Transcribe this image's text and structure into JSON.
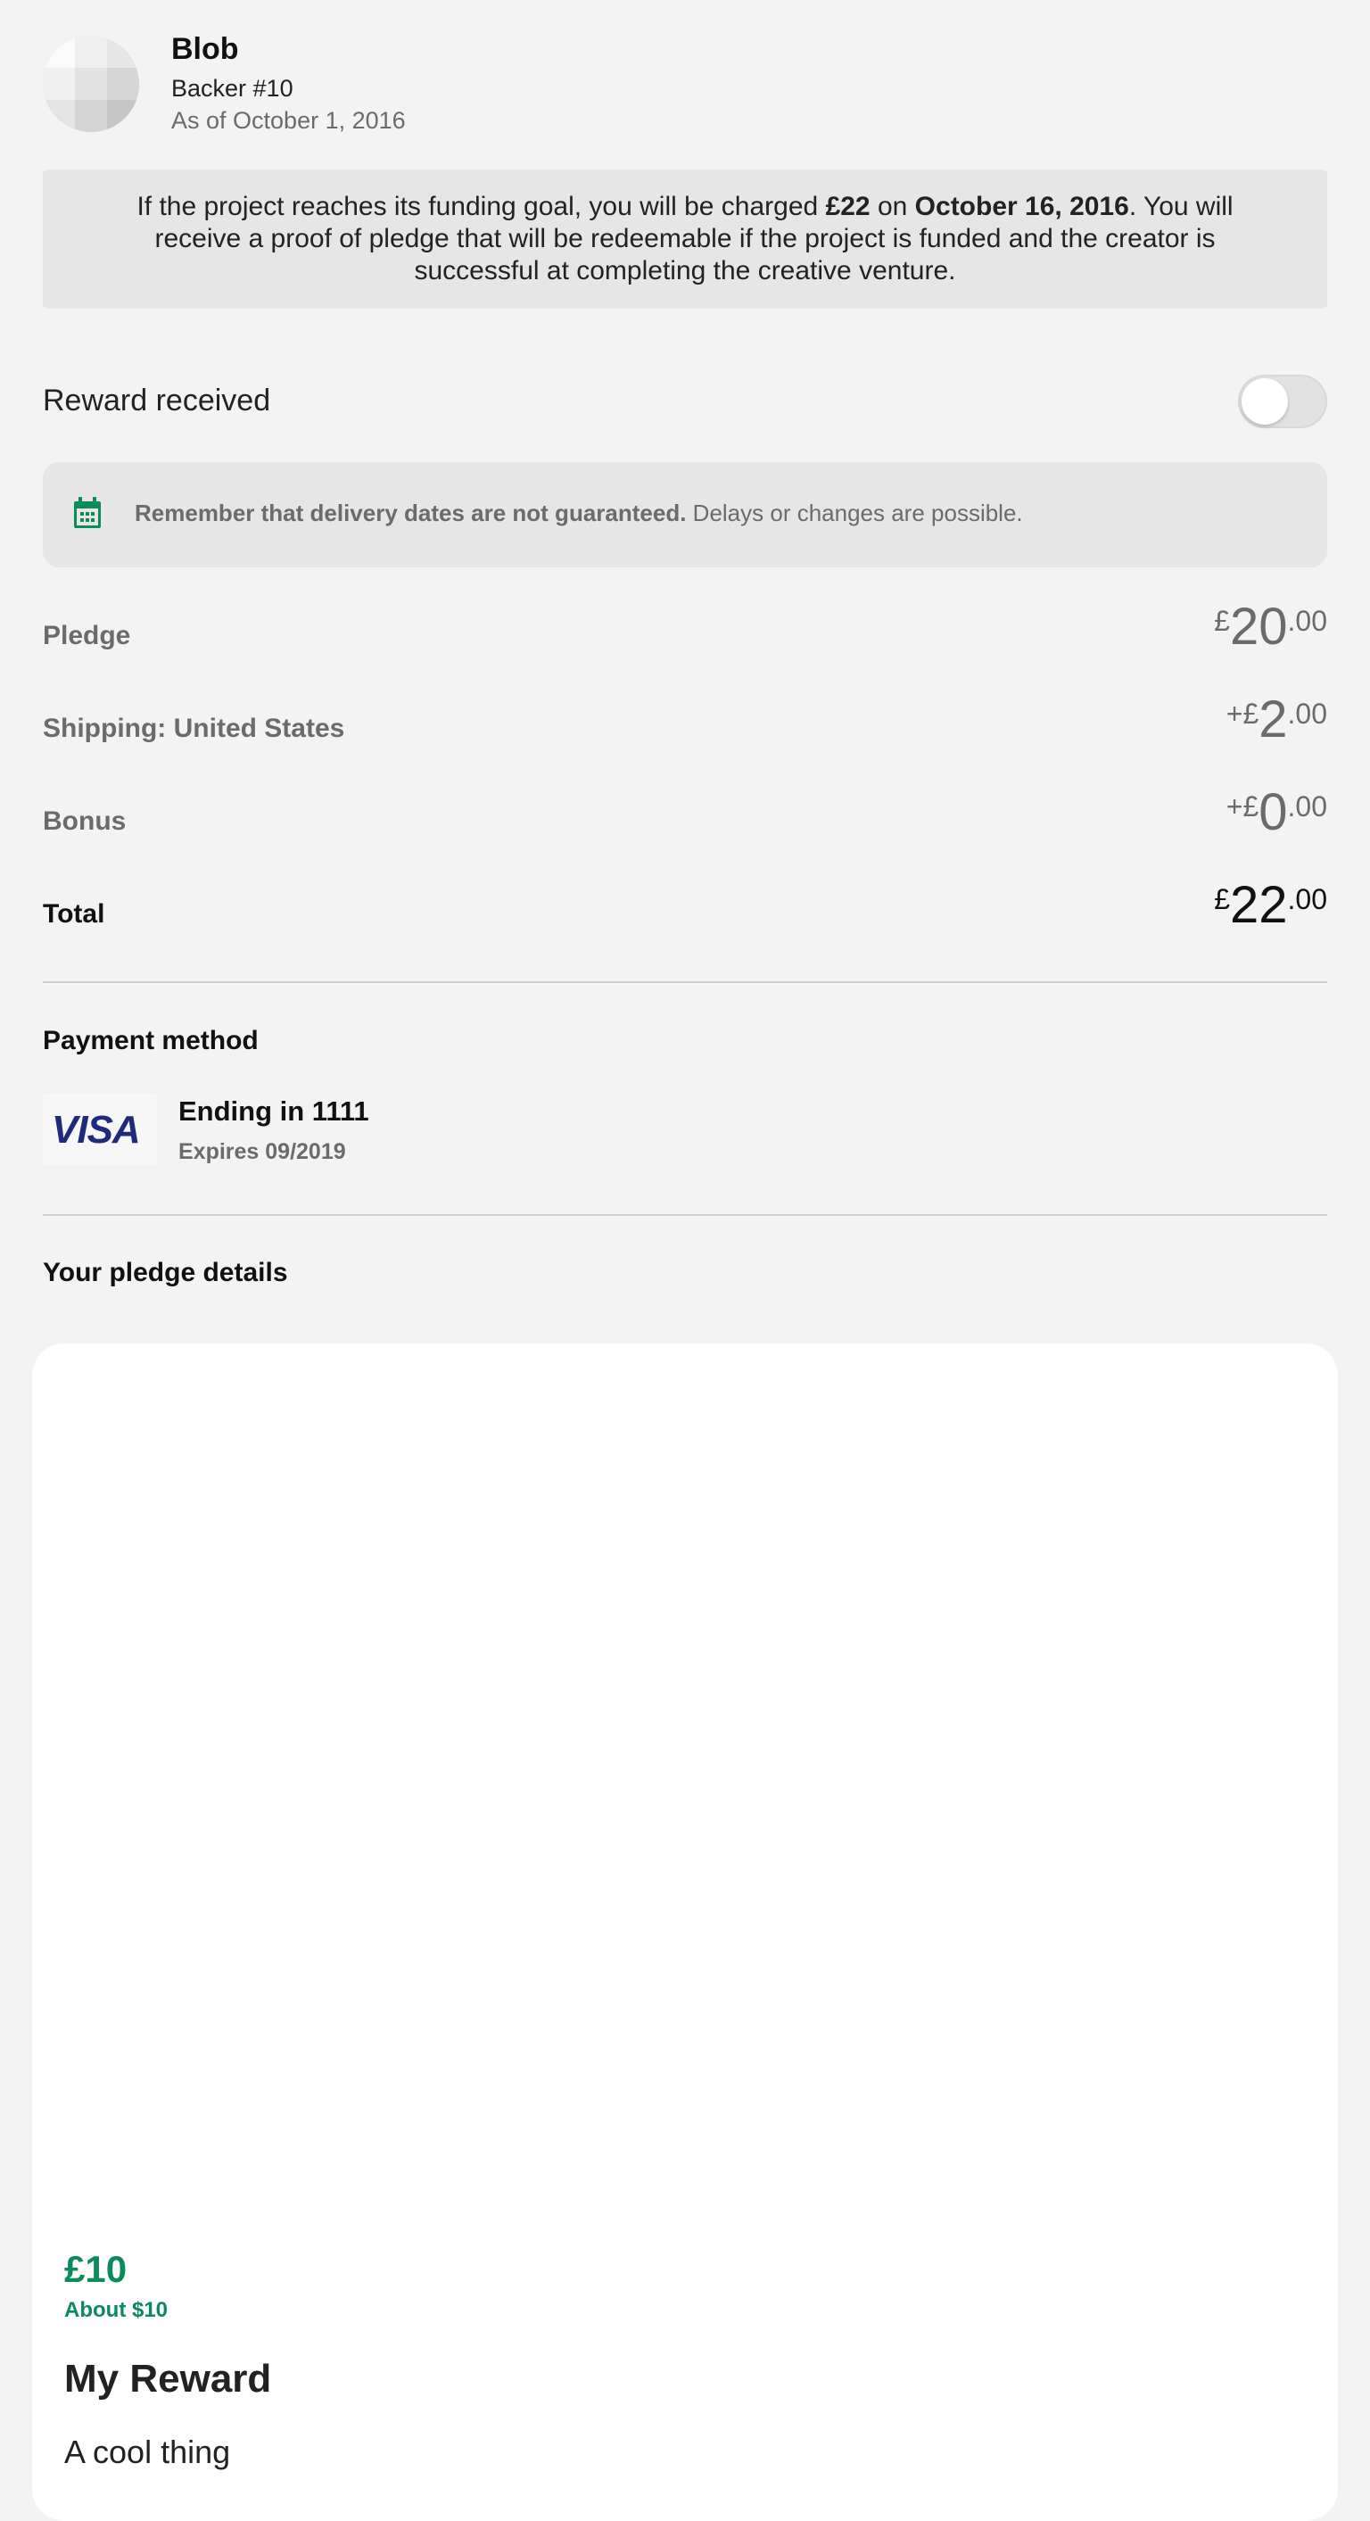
{
  "header": {
    "name": "Blob",
    "backer": "Backer #10",
    "as_of": "As of October 1, 2016"
  },
  "notice": {
    "part1": "If the project reaches its funding goal, you will be charged ",
    "amount": "£22",
    "part2": " on ",
    "date": "October 16, 2016",
    "part3": ". You will receive a proof of pledge that will be redeemable if the project is funded and the creator is successful at completing the creative venture."
  },
  "reward_received": {
    "label": "Reward received",
    "toggle_on": false
  },
  "delivery_note": {
    "icon": "calendar-icon",
    "bold": "Remember that delivery dates are not guaranteed.",
    "rest": " Delays or changes are possible."
  },
  "lines": {
    "pledge": {
      "label": "Pledge",
      "prefix": "£",
      "whole": "20",
      "cents": ".00"
    },
    "shipping": {
      "label": "Shipping: United States",
      "prefix": "+£",
      "whole": "2",
      "cents": ".00"
    },
    "bonus": {
      "label": "Bonus",
      "prefix": "+£",
      "whole": "0",
      "cents": ".00"
    },
    "total": {
      "label": "Total",
      "prefix": "£",
      "whole": "22",
      "cents": ".00"
    }
  },
  "payment": {
    "title": "Payment method",
    "brand": "VISA",
    "ending": "Ending in 1111",
    "expires": "Expires 09/2019"
  },
  "pledge_details": {
    "title": "Your pledge details"
  },
  "reward": {
    "price": "£10",
    "about": "About $10",
    "title": "My Reward",
    "description": "A cool thing"
  },
  "colors": {
    "accent_green": "#0b8a5a",
    "background": "#f3f3f3",
    "visa_blue": "#1f2a7a"
  }
}
